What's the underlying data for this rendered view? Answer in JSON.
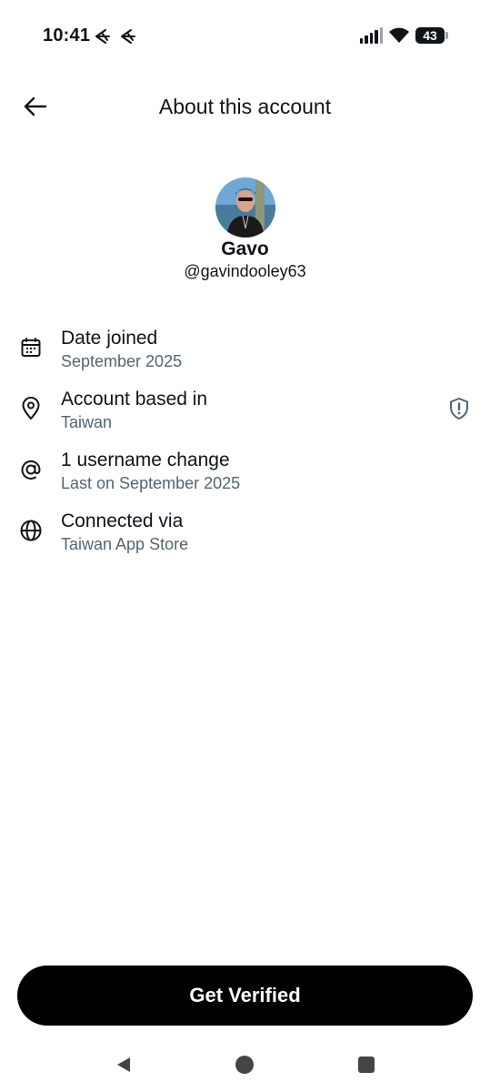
{
  "status_bar": {
    "time": "10:41",
    "battery_level": "43",
    "icons": [
      "notification-icon",
      "notification-icon",
      "signal-icon",
      "wifi-icon",
      "battery-icon"
    ]
  },
  "header": {
    "title": "About this account",
    "back_icon": "arrow-left-icon"
  },
  "profile": {
    "display_name": "Gavo",
    "handle": "@gavindooley63"
  },
  "info_rows": [
    {
      "icon": "calendar-icon",
      "title": "Date joined",
      "subtitle": "September 2025"
    },
    {
      "icon": "location-pin-icon",
      "title": "Account based in",
      "subtitle": "Taiwan",
      "trailing_icon": "shield-alert-icon"
    },
    {
      "icon": "at-sign-icon",
      "title": "1 username change",
      "subtitle": "Last on September 2025"
    },
    {
      "icon": "globe-icon",
      "title": "Connected via",
      "subtitle": "Taiwan App Store"
    }
  ],
  "cta": {
    "label": "Get Verified"
  },
  "nav": [
    "back-triangle-icon",
    "home-circle-icon",
    "recents-square-icon"
  ],
  "colors": {
    "text": "#0f1419",
    "secondary": "#536471",
    "button_bg": "#000000",
    "button_text": "#ffffff"
  }
}
